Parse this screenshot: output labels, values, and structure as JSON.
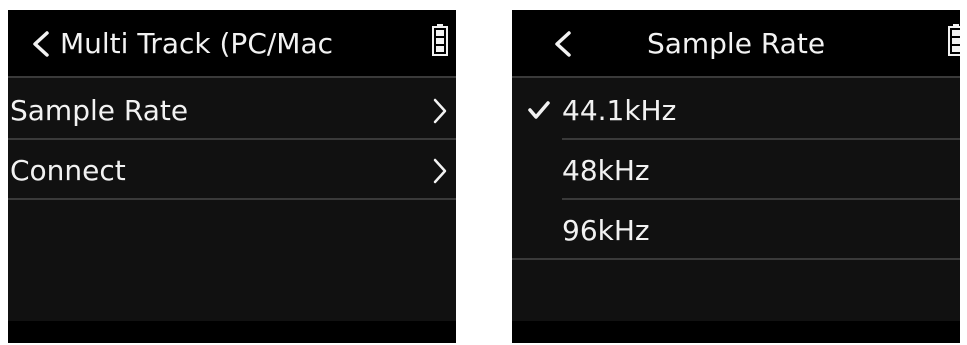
{
  "left_screen": {
    "title": "Multi Track (PC/Mac",
    "items": [
      {
        "label": "Sample Rate"
      },
      {
        "label": "Connect"
      }
    ]
  },
  "right_screen": {
    "title": "Sample Rate",
    "options": [
      {
        "label": "44.1kHz",
        "selected": true
      },
      {
        "label": "48kHz",
        "selected": false
      },
      {
        "label": "96kHz",
        "selected": false
      }
    ]
  },
  "icons": {
    "back": "chevron-left-icon",
    "battery": "battery-icon",
    "submenu": "chevron-right-icon",
    "selected": "check-icon"
  },
  "colors": {
    "screen_background": "#111111",
    "header_background": "#000000",
    "text": "#f2f2f2",
    "divider": "#3a3a3a",
    "battery_fill": "#f2f2f2"
  }
}
